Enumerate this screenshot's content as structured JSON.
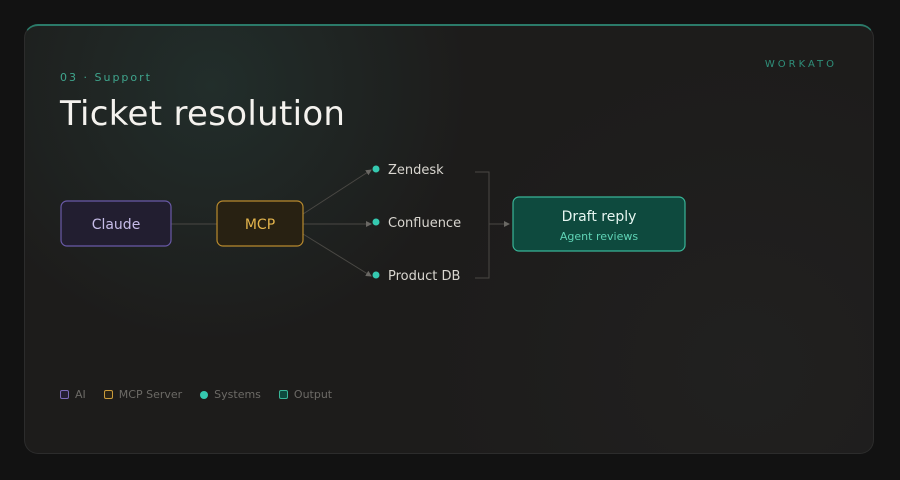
{
  "slide": {
    "eyebrow": "03 · Support",
    "brand": "WORKATO",
    "title": "Ticket resolution"
  },
  "diagram": {
    "ai_node": "Claude",
    "mcp_node": "MCP",
    "systems": [
      "Zendesk",
      "Confluence",
      "Product DB"
    ],
    "output": {
      "title": "Draft reply",
      "subtitle": "Agent reviews"
    }
  },
  "legend": {
    "ai": "AI",
    "mcp": "MCP Server",
    "systems": "Systems",
    "output": "Output"
  },
  "colors": {
    "ai": "#7b6ab8",
    "mcp": "#c99a3a",
    "systems": "#35c9b0",
    "output": "#38b597",
    "accent_line": "#2b7a69"
  }
}
